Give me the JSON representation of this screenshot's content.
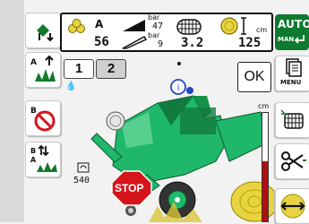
{
  "status_bar": {
    "bale_icon": "bale-count-icon",
    "bale_label": "A",
    "bale_count": "56",
    "pressure_unit": "bar",
    "pressure_value": "47",
    "knife_unit": "bar",
    "knife_value": "9",
    "net_wraps": "3.2",
    "bale_diameter": "125",
    "diameter_unit": "cm"
  },
  "tabs": [
    {
      "label": "1"
    },
    {
      "label": "2"
    }
  ],
  "ok_label": "OK",
  "auto_button": {
    "label": "AUTO",
    "sub_label": "MAN"
  },
  "menu_label": "MENU",
  "counter_value": "540",
  "stop_label": "STOP",
  "scale_unit": "cm",
  "scale_level": 0.55,
  "colors": {
    "machine_green": "#1fb86b",
    "auto_green": "#0d7a2e",
    "stop_red": "#d6141c",
    "bale_yellow": "#e8d440"
  }
}
